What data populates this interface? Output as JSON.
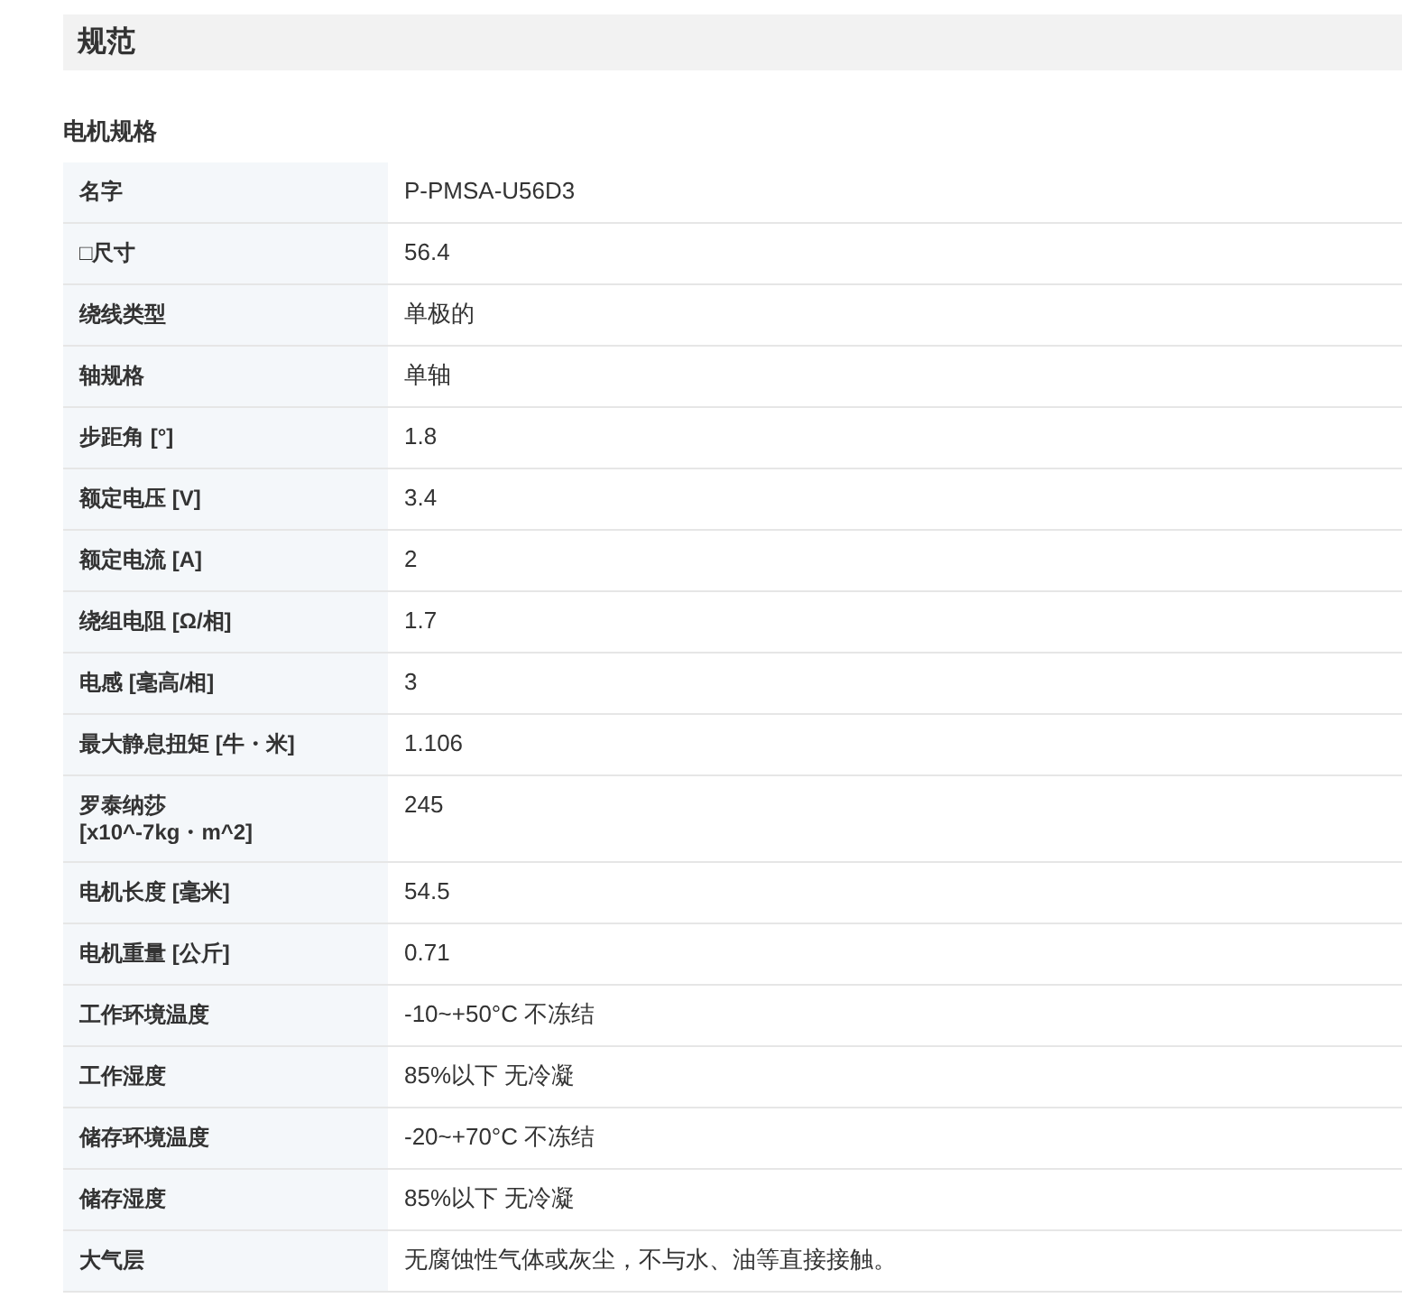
{
  "header": {
    "title": "规范"
  },
  "section": {
    "title": "电机规格"
  },
  "table": {
    "rows": [
      {
        "label": "名字",
        "value": "P-PMSA-U56D3"
      },
      {
        "label": "□尺寸",
        "value": "56.4"
      },
      {
        "label": "绕线类型",
        "value": "单极的"
      },
      {
        "label": "轴规格",
        "value": "单轴"
      },
      {
        "label": "步距角 [°]",
        "value": "1.8"
      },
      {
        "label": "额定电压 [V]",
        "value": "3.4"
      },
      {
        "label": "额定电流 [A]",
        "value": "2"
      },
      {
        "label": "绕组电阻 [Ω/相]",
        "value": "1.7"
      },
      {
        "label": "电感 [毫高/相]",
        "value": "3"
      },
      {
        "label": "最大静息扭矩 [牛・米]",
        "value": "1.106"
      },
      {
        "label": "罗泰纳莎\n[x10^-7kg・m^2]",
        "value": "245"
      },
      {
        "label": "电机长度 [毫米]",
        "value": "54.5"
      },
      {
        "label": "电机重量 [公斤]",
        "value": "0.71"
      },
      {
        "label": "工作环境温度",
        "value": "-10~+50°C 不冻结"
      },
      {
        "label": "工作湿度",
        "value": "85%以下 无冷凝"
      },
      {
        "label": "储存环境温度",
        "value": "-20~+70°C 不冻结"
      },
      {
        "label": "储存湿度",
        "value": "85%以下 无冷凝"
      },
      {
        "label": "大气层",
        "value": "无腐蚀性气体或灰尘，不与水、油等直接接触。"
      }
    ]
  }
}
